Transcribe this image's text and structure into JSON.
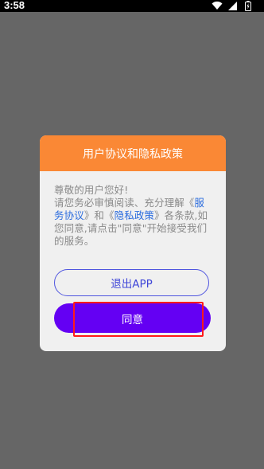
{
  "status_bar": {
    "time": "3:58",
    "icons": [
      "wifi-icon",
      "cellular-signal-icon",
      "battery-icon"
    ]
  },
  "dialog": {
    "title": "用户协议和隐私政策",
    "greeting": "尊敬的用户您好!",
    "text_before_link1": "请您务必审慎阅读、充分理解《",
    "link_service_agreement": "服务协议",
    "text_between_links": "》和《",
    "link_privacy_policy": "隐私政策",
    "text_after_links": "》各条款,如您同意,请点击\"同意\"开始接受我们的服务。",
    "exit_button_label": "退出APP",
    "agree_button_label": "同意"
  },
  "colors": {
    "backdrop": "#666666",
    "header": "#fa8835",
    "agree_button": "#6400f3",
    "link": "#2b6cde",
    "highlight": "#ff1a1a"
  }
}
